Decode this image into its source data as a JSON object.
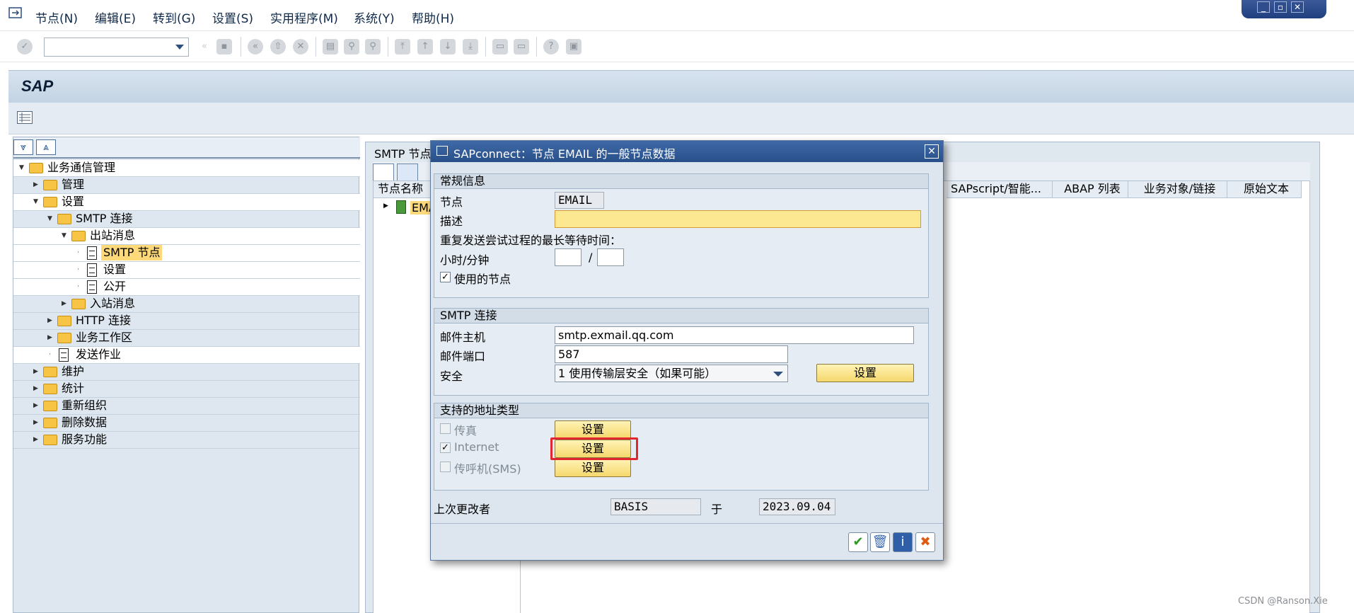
{
  "menu": {
    "items": [
      "节点(N)",
      "编辑(E)",
      "转到(G)",
      "设置(S)",
      "实用程序(M)",
      "系统(Y)",
      "帮助(H)"
    ]
  },
  "header": {
    "title": "SAP"
  },
  "tree": {
    "items": [
      {
        "label": "业务通信管理"
      },
      {
        "label": "管理"
      },
      {
        "label": "设置"
      },
      {
        "label": "SMTP 连接"
      },
      {
        "label": "出站消息"
      },
      {
        "label": "SMTP 节点"
      },
      {
        "label": "设置"
      },
      {
        "label": "公开"
      },
      {
        "label": "入站消息"
      },
      {
        "label": "HTTP 连接"
      },
      {
        "label": "业务工作区"
      },
      {
        "label": "发送作业"
      },
      {
        "label": "维护"
      },
      {
        "label": "统计"
      },
      {
        "label": "重新组织"
      },
      {
        "label": "删除数据"
      },
      {
        "label": "服务功能"
      }
    ]
  },
  "right_panel": {
    "title": "SMTP 节点",
    "columns": [
      "节点名称",
      "SAPscript/智能...",
      "ABAP 列表",
      "业务对象/链接",
      "原始文本"
    ],
    "node_value": "EMA"
  },
  "dialog": {
    "title": "SAPconnect：节点 EMAIL 的一般节点数据",
    "general": {
      "section_title": "常规信息",
      "node_label": "节点",
      "node_value": "EMAIL",
      "desc_label": "描述",
      "desc_value": "",
      "retry_text": "重复发送尝试过程的最长等待时间：",
      "hm_label": "小时/分钟",
      "hm_sep": "/",
      "used_node_label": "使用的节点",
      "used_node_checked": "✓"
    },
    "smtp": {
      "section_title": "SMTP 连接",
      "host_label": "邮件主机",
      "host_value": "smtp.exmail.qq.com",
      "port_label": "邮件端口",
      "port_value": "587",
      "security_label": "安全",
      "security_value": "1 使用传输层安全（如果可能）",
      "settings_button": "设置"
    },
    "address_types": {
      "section_title": "支持的地址类型",
      "items": [
        {
          "label": "传真",
          "checked": "",
          "button": "设置"
        },
        {
          "label": "Internet",
          "checked": "✓",
          "button": "设置"
        },
        {
          "label": "传呼机(SMS)",
          "checked": "",
          "button": "设置"
        }
      ]
    },
    "footer": {
      "changed_by_label": "上次更改者",
      "changed_by_value": "BASIS",
      "at_label": "于",
      "date_value": "2023.09.04"
    },
    "close_symbol": "✕"
  },
  "watermark": "CSDN @Ranson.Xie",
  "colors": {
    "title_bar_accent": "#284f8a",
    "button_yellow": "#f5d86c",
    "selection_yellow": "#fdd97a",
    "highlight_red": "#e2262d"
  }
}
